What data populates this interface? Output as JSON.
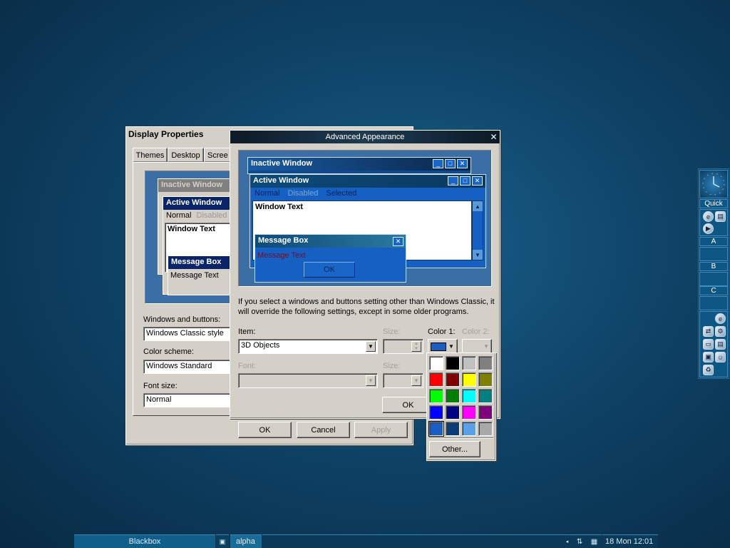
{
  "display_properties": {
    "title": "Display Properties",
    "tabs": [
      "Themes",
      "Desktop",
      "Scree"
    ],
    "preview": {
      "inactive_title": "Inactive Window",
      "active_title": "Active Window",
      "menu": [
        "Normal",
        "Disabled"
      ],
      "window_text": "Window Text",
      "msgbox_title": "Message Box",
      "msgbox_text": "Message Text"
    },
    "windows_and_buttons_label": "Windows and buttons:",
    "windows_and_buttons_value": "Windows Classic style",
    "color_scheme_label": "Color scheme:",
    "color_scheme_value": "Windows Standard",
    "font_size_label": "Font size:",
    "font_size_value": "Normal",
    "ok": "OK",
    "cancel": "Cancel",
    "apply": "Apply"
  },
  "advanced": {
    "title": "Advanced Appearance",
    "close_glyph": "✕",
    "preview": {
      "inactive_title": "Inactive Window",
      "active_title": "Active Window",
      "menu": [
        "Normal",
        "Disabled",
        "Selected"
      ],
      "window_text": "Window Text",
      "msgbox_title": "Message Box",
      "msgbox_text": "Message Text",
      "msgbox_ok": "OK"
    },
    "info_text": "If you select a windows and buttons setting other than Windows Classic, it will override the following settings, except in some older programs.",
    "item_label": "Item:",
    "item_value": "3D Objects",
    "size_label": "Size:",
    "color1_label": "Color 1:",
    "color2_label": "Color 2:",
    "font_label": "Font:",
    "font_size_label": "Size:",
    "ok": "OK",
    "color1_value": "#1a5ec4"
  },
  "palette": {
    "colors": [
      "#ffffff",
      "#000000",
      "#c0c0c0",
      "#808080",
      "#ff0000",
      "#800000",
      "#ffff00",
      "#808000",
      "#00ff00",
      "#008000",
      "#00ffff",
      "#008080",
      "#0000ff",
      "#000080",
      "#ff00ff",
      "#800080",
      "#1a5ec4",
      "#0a3c78",
      "#5aa0e6",
      "#a8a8a8"
    ],
    "selected_index": 16,
    "other_label": "Other..."
  },
  "slit": {
    "quick_label": "Quick",
    "workspaces": [
      "A",
      "B",
      "C"
    ]
  },
  "taskbar": {
    "workspace_name": "Blackbox",
    "task": "alpha",
    "clock": "18 Mon 12:01"
  }
}
